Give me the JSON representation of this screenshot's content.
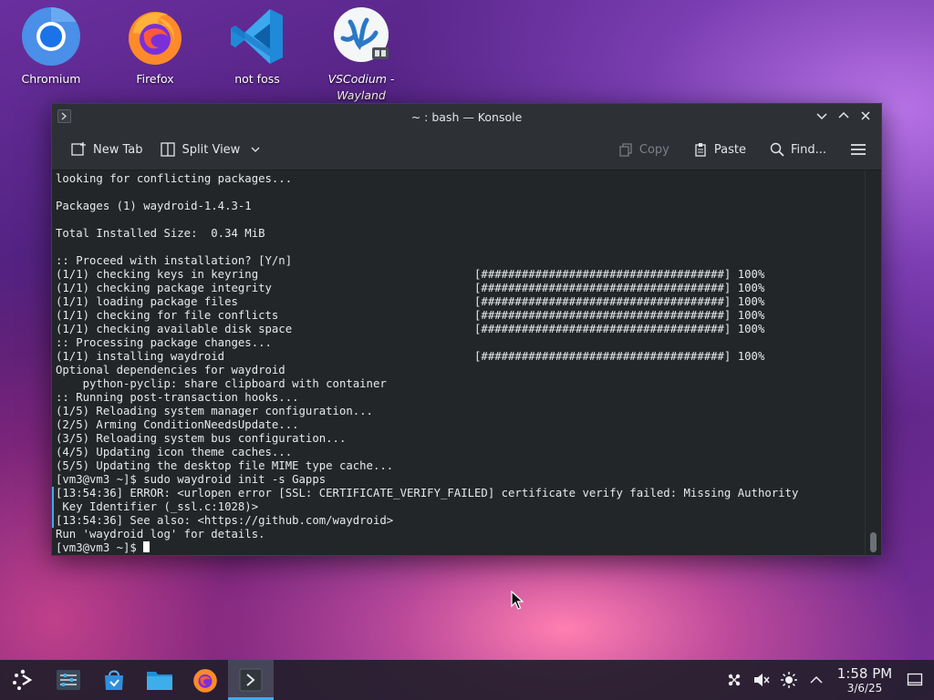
{
  "desktop": {
    "icons": [
      {
        "label": "Chromium",
        "icon": "chromium-icon"
      },
      {
        "label": "Firefox",
        "icon": "firefox-icon"
      },
      {
        "label": "not foss",
        "icon": "vscode-icon"
      },
      {
        "label": "VSCodium - Wayland",
        "icon": "vscodium-icon"
      }
    ]
  },
  "window": {
    "title": "~ : bash — Konsole",
    "toolbar": {
      "new_tab": "New Tab",
      "split_view": "Split View",
      "copy": "Copy",
      "paste": "Paste",
      "find": "Find..."
    },
    "terminal_lines": [
      "looking for conflicting packages...",
      "",
      "Packages (1) waydroid-1.4.3-1",
      "",
      "Total Installed Size:  0.34 MiB",
      "",
      ":: Proceed with installation? [Y/n]",
      "(1/1) checking keys in keyring                                [####################################] 100%",
      "(1/1) checking package integrity                              [####################################] 100%",
      "(1/1) loading package files                                   [####################################] 100%",
      "(1/1) checking for file conflicts                             [####################################] 100%",
      "(1/1) checking available disk space                           [####################################] 100%",
      ":: Processing package changes...",
      "(1/1) installing waydroid                                     [####################################] 100%",
      "Optional dependencies for waydroid",
      "    python-pyclip: share clipboard with container",
      ":: Running post-transaction hooks...",
      "(1/5) Reloading system manager configuration...",
      "(2/5) Arming ConditionNeedsUpdate...",
      "(3/5) Reloading system bus configuration...",
      "(4/5) Updating icon theme caches...",
      "(5/5) Updating the desktop file MIME type cache...",
      "[vm3@vm3 ~]$ sudo waydroid init -s Gapps",
      "[13:54:36] ERROR: <urlopen error [SSL: CERTIFICATE_VERIFY_FAILED] certificate verify failed: Missing Authority",
      " Key Identifier (_ssl.c:1028)>",
      "[13:54:36] See also: <https://github.com/waydroid>",
      "Run 'waydroid log' for details."
    ],
    "prompt": "[vm3@vm3 ~]$ "
  },
  "taskbar": {
    "time": "1:58 PM",
    "date": "3/6/25"
  },
  "colors": {
    "accent": "#3daee9",
    "terminal_bg": "#232629",
    "terminal_fg": "#e7e9ea"
  }
}
